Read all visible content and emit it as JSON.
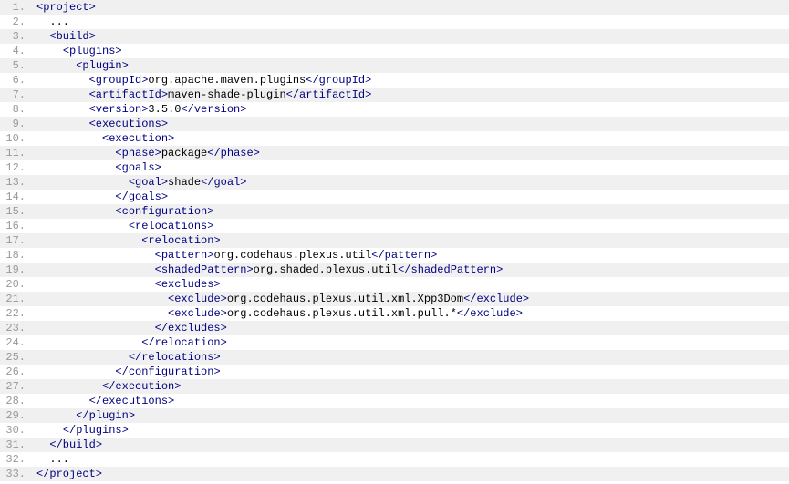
{
  "lines": [
    {
      "n": 1,
      "indent": "",
      "segments": [
        {
          "t": "tag",
          "v": "<project>"
        }
      ]
    },
    {
      "n": 2,
      "indent": "  ",
      "segments": [
        {
          "t": "text",
          "v": "..."
        }
      ]
    },
    {
      "n": 3,
      "indent": "  ",
      "segments": [
        {
          "t": "tag",
          "v": "<build>"
        }
      ]
    },
    {
      "n": 4,
      "indent": "    ",
      "segments": [
        {
          "t": "tag",
          "v": "<plugins>"
        }
      ]
    },
    {
      "n": 5,
      "indent": "      ",
      "segments": [
        {
          "t": "tag",
          "v": "<plugin>"
        }
      ]
    },
    {
      "n": 6,
      "indent": "        ",
      "segments": [
        {
          "t": "tag",
          "v": "<groupId>"
        },
        {
          "t": "text",
          "v": "org.apache.maven.plugins"
        },
        {
          "t": "tag",
          "v": "</groupId>"
        }
      ]
    },
    {
      "n": 7,
      "indent": "        ",
      "segments": [
        {
          "t": "tag",
          "v": "<artifactId>"
        },
        {
          "t": "text",
          "v": "maven-shade-plugin"
        },
        {
          "t": "tag",
          "v": "</artifactId>"
        }
      ]
    },
    {
      "n": 8,
      "indent": "        ",
      "segments": [
        {
          "t": "tag",
          "v": "<version>"
        },
        {
          "t": "text",
          "v": "3.5.0"
        },
        {
          "t": "tag",
          "v": "</version>"
        }
      ]
    },
    {
      "n": 9,
      "indent": "        ",
      "segments": [
        {
          "t": "tag",
          "v": "<executions>"
        }
      ]
    },
    {
      "n": 10,
      "indent": "          ",
      "segments": [
        {
          "t": "tag",
          "v": "<execution>"
        }
      ]
    },
    {
      "n": 11,
      "indent": "            ",
      "segments": [
        {
          "t": "tag",
          "v": "<phase>"
        },
        {
          "t": "text",
          "v": "package"
        },
        {
          "t": "tag",
          "v": "</phase>"
        }
      ]
    },
    {
      "n": 12,
      "indent": "            ",
      "segments": [
        {
          "t": "tag",
          "v": "<goals>"
        }
      ]
    },
    {
      "n": 13,
      "indent": "              ",
      "segments": [
        {
          "t": "tag",
          "v": "<goal>"
        },
        {
          "t": "text",
          "v": "shade"
        },
        {
          "t": "tag",
          "v": "</goal>"
        }
      ]
    },
    {
      "n": 14,
      "indent": "            ",
      "segments": [
        {
          "t": "tag",
          "v": "</goals>"
        }
      ]
    },
    {
      "n": 15,
      "indent": "            ",
      "segments": [
        {
          "t": "tag",
          "v": "<configuration>"
        }
      ]
    },
    {
      "n": 16,
      "indent": "              ",
      "segments": [
        {
          "t": "tag",
          "v": "<relocations>"
        }
      ]
    },
    {
      "n": 17,
      "indent": "                ",
      "segments": [
        {
          "t": "tag",
          "v": "<relocation>"
        }
      ]
    },
    {
      "n": 18,
      "indent": "                  ",
      "segments": [
        {
          "t": "tag",
          "v": "<pattern>"
        },
        {
          "t": "text",
          "v": "org.codehaus.plexus.util"
        },
        {
          "t": "tag",
          "v": "</pattern>"
        }
      ]
    },
    {
      "n": 19,
      "indent": "                  ",
      "segments": [
        {
          "t": "tag",
          "v": "<shadedPattern>"
        },
        {
          "t": "text",
          "v": "org.shaded.plexus.util"
        },
        {
          "t": "tag",
          "v": "</shadedPattern>"
        }
      ]
    },
    {
      "n": 20,
      "indent": "                  ",
      "segments": [
        {
          "t": "tag",
          "v": "<excludes>"
        }
      ]
    },
    {
      "n": 21,
      "indent": "                    ",
      "segments": [
        {
          "t": "tag",
          "v": "<exclude>"
        },
        {
          "t": "text",
          "v": "org.codehaus.plexus.util.xml.Xpp3Dom"
        },
        {
          "t": "tag",
          "v": "</exclude>"
        }
      ]
    },
    {
      "n": 22,
      "indent": "                    ",
      "segments": [
        {
          "t": "tag",
          "v": "<exclude>"
        },
        {
          "t": "text",
          "v": "org.codehaus.plexus.util.xml.pull.*"
        },
        {
          "t": "tag",
          "v": "</exclude>"
        }
      ]
    },
    {
      "n": 23,
      "indent": "                  ",
      "segments": [
        {
          "t": "tag",
          "v": "</excludes>"
        }
      ]
    },
    {
      "n": 24,
      "indent": "                ",
      "segments": [
        {
          "t": "tag",
          "v": "</relocation>"
        }
      ]
    },
    {
      "n": 25,
      "indent": "              ",
      "segments": [
        {
          "t": "tag",
          "v": "</relocations>"
        }
      ]
    },
    {
      "n": 26,
      "indent": "            ",
      "segments": [
        {
          "t": "tag",
          "v": "</configuration>"
        }
      ]
    },
    {
      "n": 27,
      "indent": "          ",
      "segments": [
        {
          "t": "tag",
          "v": "</execution>"
        }
      ]
    },
    {
      "n": 28,
      "indent": "        ",
      "segments": [
        {
          "t": "tag",
          "v": "</executions>"
        }
      ]
    },
    {
      "n": 29,
      "indent": "      ",
      "segments": [
        {
          "t": "tag",
          "v": "</plugin>"
        }
      ]
    },
    {
      "n": 30,
      "indent": "    ",
      "segments": [
        {
          "t": "tag",
          "v": "</plugins>"
        }
      ]
    },
    {
      "n": 31,
      "indent": "  ",
      "segments": [
        {
          "t": "tag",
          "v": "</build>"
        }
      ]
    },
    {
      "n": 32,
      "indent": "  ",
      "segments": [
        {
          "t": "text",
          "v": "..."
        }
      ]
    },
    {
      "n": 33,
      "indent": "",
      "segments": [
        {
          "t": "tag",
          "v": "</project>"
        }
      ]
    }
  ]
}
